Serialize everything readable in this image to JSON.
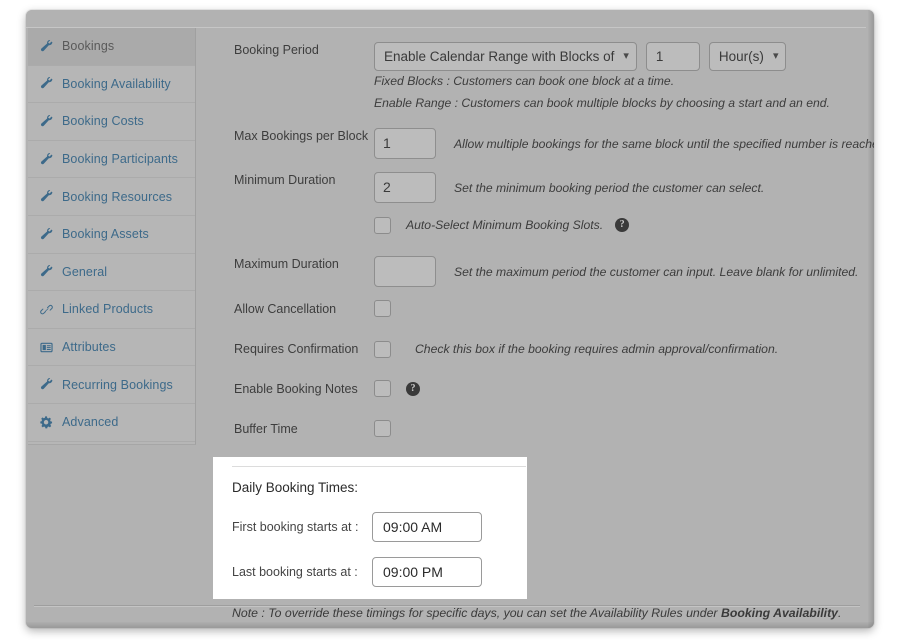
{
  "sidebar": {
    "items": [
      {
        "label": "Bookings",
        "icon": "wrench-icon",
        "active": true
      },
      {
        "label": "Booking Availability",
        "icon": "wrench-icon",
        "active": false
      },
      {
        "label": "Booking Costs",
        "icon": "wrench-icon",
        "active": false
      },
      {
        "label": "Booking Participants",
        "icon": "wrench-icon",
        "active": false
      },
      {
        "label": "Booking Resources",
        "icon": "wrench-icon",
        "active": false
      },
      {
        "label": "Booking Assets",
        "icon": "wrench-icon",
        "active": false
      },
      {
        "label": "General",
        "icon": "wrench-icon",
        "active": false
      },
      {
        "label": "Linked Products",
        "icon": "link-icon",
        "active": false
      },
      {
        "label": "Attributes",
        "icon": "attributes-icon",
        "active": false
      },
      {
        "label": "Recurring Bookings",
        "icon": "wrench-icon",
        "active": false
      },
      {
        "label": "Advanced",
        "icon": "gear-icon",
        "active": false
      }
    ]
  },
  "form": {
    "booking_period": {
      "label": "Booking Period",
      "mode_value": "Enable Calendar Range with Blocks of",
      "block_count": "1",
      "unit_value": "Hour(s)",
      "hint1": "Fixed Blocks : Customers can book one block at a time.",
      "hint2": "Enable Range : Customers can book multiple blocks by choosing a start and an end."
    },
    "max_bookings_per_block": {
      "label": "Max Bookings per Block",
      "value": "1",
      "hint": "Allow multiple bookings for the same block until the specified number is reached."
    },
    "minimum_duration": {
      "label": "Minimum Duration",
      "value": "2",
      "hint": "Set the minimum booking period the customer can select."
    },
    "auto_select": {
      "label": "Auto-Select Minimum Booking Slots.",
      "checked": false
    },
    "maximum_duration": {
      "label": "Maximum Duration",
      "value": "",
      "hint": "Set the maximum period the customer can input. Leave blank for unlimited."
    },
    "allow_cancellation": {
      "label": "Allow Cancellation",
      "checked": false
    },
    "requires_confirmation": {
      "label": "Requires Confirmation",
      "checked": false,
      "hint": "Check this box if the booking requires admin approval/confirmation."
    },
    "enable_booking_notes": {
      "label": "Enable Booking Notes",
      "checked": false
    },
    "buffer_time": {
      "label": "Buffer Time",
      "checked": false
    }
  },
  "daily_booking_times": {
    "title": "Daily Booking Times:",
    "first_label": "First booking starts at :",
    "first_value": "09:00 AM",
    "last_label": "Last booking starts at :",
    "last_value": "09:00 PM"
  },
  "note": {
    "prefix": "Note : To override these timings for specific days, you can set the Availability Rules under ",
    "emphasis": "Booking Availability",
    "suffix": "."
  },
  "colors": {
    "panel_bg": "#b2b2b2",
    "sidebar_bg": "#b6b6b6",
    "sidebar_active_bg": "#aaaaaa",
    "link_blue": "#3d6a8a",
    "spotlight_bg": "#ffffff"
  }
}
